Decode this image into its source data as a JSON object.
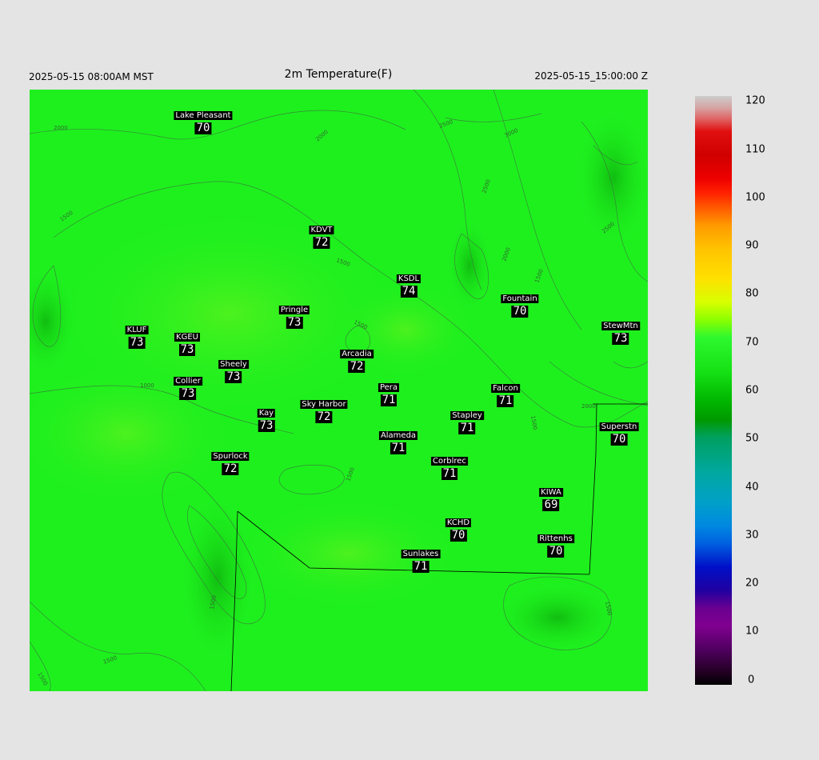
{
  "header": {
    "local_time": "2025-05-15 08:00AM MST",
    "title": "2m Temperature(F)",
    "utc_time": "2025-05-15_15:00:00 Z"
  },
  "stations": [
    {
      "name": "Lake Pleasant",
      "value": "70"
    },
    {
      "name": "KDVT",
      "value": "72"
    },
    {
      "name": "KSDL",
      "value": "74"
    },
    {
      "name": "Fountain",
      "value": "70"
    },
    {
      "name": "StewMtn",
      "value": "73"
    },
    {
      "name": "Pringle",
      "value": "73"
    },
    {
      "name": "KLUF",
      "value": "73"
    },
    {
      "name": "KGEU",
      "value": "73"
    },
    {
      "name": "Arcadia",
      "value": "72"
    },
    {
      "name": "Sheely",
      "value": "73"
    },
    {
      "name": "Collier",
      "value": "73"
    },
    {
      "name": "Pera",
      "value": "71"
    },
    {
      "name": "Falcon",
      "value": "71"
    },
    {
      "name": "Kay",
      "value": "73"
    },
    {
      "name": "Sky Harbor",
      "value": "72"
    },
    {
      "name": "Stapley",
      "value": "71"
    },
    {
      "name": "Superstn",
      "value": "70"
    },
    {
      "name": "Alameda",
      "value": "71"
    },
    {
      "name": "Spurlock",
      "value": "72"
    },
    {
      "name": "Corblrec",
      "value": "71"
    },
    {
      "name": "KIWA",
      "value": "69"
    },
    {
      "name": "KCHD",
      "value": "70"
    },
    {
      "name": "Rittenhs",
      "value": "70"
    },
    {
      "name": "Sunlakes",
      "value": "71"
    }
  ],
  "contour_labels": [
    "2000",
    "1500",
    "1500",
    "1500",
    "1000",
    "2000",
    "2500",
    "3000",
    "2500",
    "2000",
    "1500",
    "2500",
    "1500",
    "2000",
    "1500",
    "1500",
    "1500",
    "1500",
    "1500"
  ],
  "colorbar": {
    "ticks": [
      "120",
      "110",
      "100",
      "90",
      "80",
      "70",
      "60",
      "50",
      "40",
      "30",
      "20",
      "10",
      "0"
    ]
  },
  "colors": {
    "map_fill": "#1ef01e",
    "background": "#e4e4e4"
  }
}
